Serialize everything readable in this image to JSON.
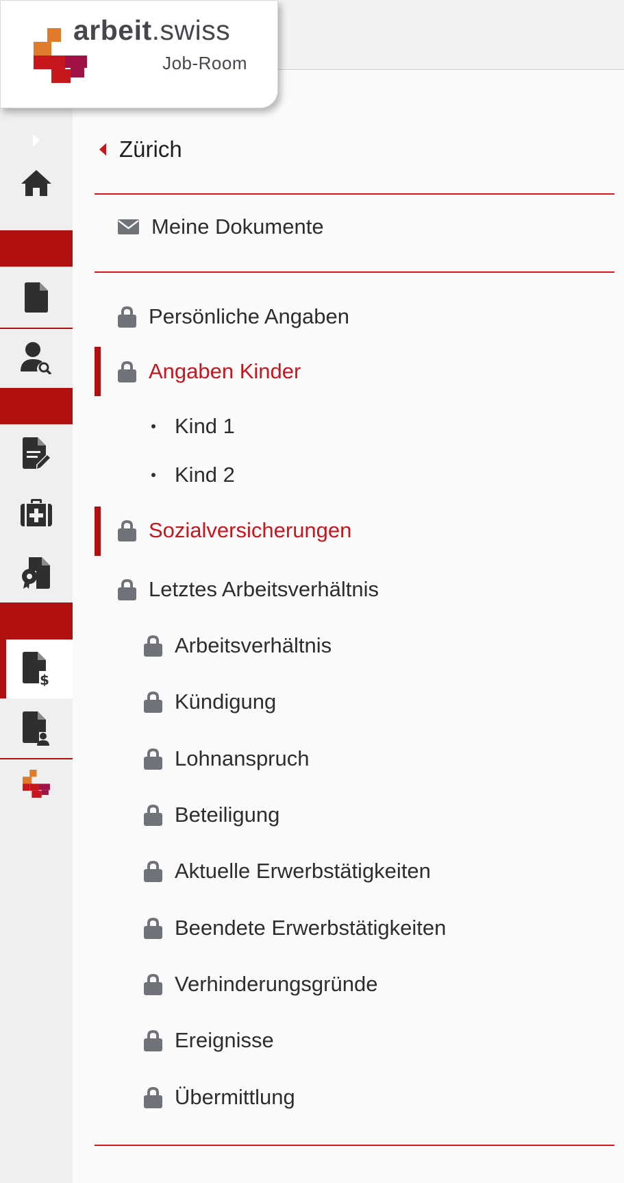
{
  "brand": {
    "title_bold": "arbeit",
    "title_rest": ".swiss",
    "subtitle": "Job-Room",
    "colors": {
      "orange": "#e07b2b",
      "red": "#c8161d",
      "dark_red": "#a01245"
    }
  },
  "rail": {
    "icons": [
      "chevron-right-icon",
      "home-icon",
      "document-icon",
      "user-search-icon",
      "document-edit-icon",
      "medical-briefcase-icon",
      "certificate-document-icon",
      "document-dollar-icon",
      "document-user-icon",
      "arbeit-swiss-logo-icon"
    ],
    "active_item": "document-dollar-icon"
  },
  "nav": {
    "back_label": "Zürich",
    "documents_label": "Meine Dokumente",
    "sections": [
      {
        "label": "Persönliche Angaben"
      },
      {
        "label": "Angaben Kinder",
        "active": true
      },
      {
        "label": "Kind 1"
      },
      {
        "label": "Kind 2"
      },
      {
        "label": "Sozialversicherungen",
        "active": true
      },
      {
        "label": "Letztes Arbeitsverhältnis"
      },
      {
        "label": "Arbeitsverhältnis"
      },
      {
        "label": "Kündigung"
      },
      {
        "label": "Lohnanspruch"
      },
      {
        "label": "Beteiligung"
      },
      {
        "label": "Aktuelle Erwerbstätigkeiten"
      },
      {
        "label": "Beendete Erwerbstätigkeiten"
      },
      {
        "label": "Verhinderungsgründe"
      },
      {
        "label": "Ereignisse"
      },
      {
        "label": "Übermittlung"
      }
    ]
  },
  "accent_color": "#c8161d"
}
